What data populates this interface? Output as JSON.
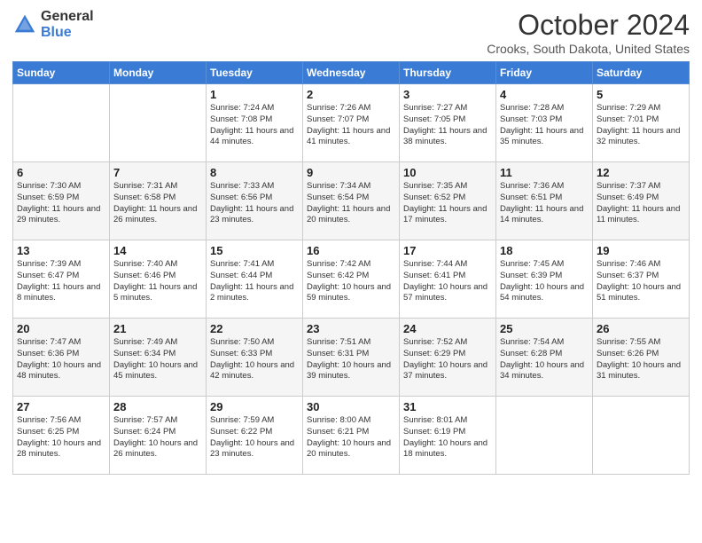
{
  "header": {
    "logo_general": "General",
    "logo_blue": "Blue",
    "month_title": "October 2024",
    "location": "Crooks, South Dakota, United States"
  },
  "days_of_week": [
    "Sunday",
    "Monday",
    "Tuesday",
    "Wednesday",
    "Thursday",
    "Friday",
    "Saturday"
  ],
  "weeks": [
    [
      {
        "day": "",
        "info": ""
      },
      {
        "day": "",
        "info": ""
      },
      {
        "day": "1",
        "info": "Sunrise: 7:24 AM\nSunset: 7:08 PM\nDaylight: 11 hours and 44 minutes."
      },
      {
        "day": "2",
        "info": "Sunrise: 7:26 AM\nSunset: 7:07 PM\nDaylight: 11 hours and 41 minutes."
      },
      {
        "day": "3",
        "info": "Sunrise: 7:27 AM\nSunset: 7:05 PM\nDaylight: 11 hours and 38 minutes."
      },
      {
        "day": "4",
        "info": "Sunrise: 7:28 AM\nSunset: 7:03 PM\nDaylight: 11 hours and 35 minutes."
      },
      {
        "day": "5",
        "info": "Sunrise: 7:29 AM\nSunset: 7:01 PM\nDaylight: 11 hours and 32 minutes."
      }
    ],
    [
      {
        "day": "6",
        "info": "Sunrise: 7:30 AM\nSunset: 6:59 PM\nDaylight: 11 hours and 29 minutes."
      },
      {
        "day": "7",
        "info": "Sunrise: 7:31 AM\nSunset: 6:58 PM\nDaylight: 11 hours and 26 minutes."
      },
      {
        "day": "8",
        "info": "Sunrise: 7:33 AM\nSunset: 6:56 PM\nDaylight: 11 hours and 23 minutes."
      },
      {
        "day": "9",
        "info": "Sunrise: 7:34 AM\nSunset: 6:54 PM\nDaylight: 11 hours and 20 minutes."
      },
      {
        "day": "10",
        "info": "Sunrise: 7:35 AM\nSunset: 6:52 PM\nDaylight: 11 hours and 17 minutes."
      },
      {
        "day": "11",
        "info": "Sunrise: 7:36 AM\nSunset: 6:51 PM\nDaylight: 11 hours and 14 minutes."
      },
      {
        "day": "12",
        "info": "Sunrise: 7:37 AM\nSunset: 6:49 PM\nDaylight: 11 hours and 11 minutes."
      }
    ],
    [
      {
        "day": "13",
        "info": "Sunrise: 7:39 AM\nSunset: 6:47 PM\nDaylight: 11 hours and 8 minutes."
      },
      {
        "day": "14",
        "info": "Sunrise: 7:40 AM\nSunset: 6:46 PM\nDaylight: 11 hours and 5 minutes."
      },
      {
        "day": "15",
        "info": "Sunrise: 7:41 AM\nSunset: 6:44 PM\nDaylight: 11 hours and 2 minutes."
      },
      {
        "day": "16",
        "info": "Sunrise: 7:42 AM\nSunset: 6:42 PM\nDaylight: 10 hours and 59 minutes."
      },
      {
        "day": "17",
        "info": "Sunrise: 7:44 AM\nSunset: 6:41 PM\nDaylight: 10 hours and 57 minutes."
      },
      {
        "day": "18",
        "info": "Sunrise: 7:45 AM\nSunset: 6:39 PM\nDaylight: 10 hours and 54 minutes."
      },
      {
        "day": "19",
        "info": "Sunrise: 7:46 AM\nSunset: 6:37 PM\nDaylight: 10 hours and 51 minutes."
      }
    ],
    [
      {
        "day": "20",
        "info": "Sunrise: 7:47 AM\nSunset: 6:36 PM\nDaylight: 10 hours and 48 minutes."
      },
      {
        "day": "21",
        "info": "Sunrise: 7:49 AM\nSunset: 6:34 PM\nDaylight: 10 hours and 45 minutes."
      },
      {
        "day": "22",
        "info": "Sunrise: 7:50 AM\nSunset: 6:33 PM\nDaylight: 10 hours and 42 minutes."
      },
      {
        "day": "23",
        "info": "Sunrise: 7:51 AM\nSunset: 6:31 PM\nDaylight: 10 hours and 39 minutes."
      },
      {
        "day": "24",
        "info": "Sunrise: 7:52 AM\nSunset: 6:29 PM\nDaylight: 10 hours and 37 minutes."
      },
      {
        "day": "25",
        "info": "Sunrise: 7:54 AM\nSunset: 6:28 PM\nDaylight: 10 hours and 34 minutes."
      },
      {
        "day": "26",
        "info": "Sunrise: 7:55 AM\nSunset: 6:26 PM\nDaylight: 10 hours and 31 minutes."
      }
    ],
    [
      {
        "day": "27",
        "info": "Sunrise: 7:56 AM\nSunset: 6:25 PM\nDaylight: 10 hours and 28 minutes."
      },
      {
        "day": "28",
        "info": "Sunrise: 7:57 AM\nSunset: 6:24 PM\nDaylight: 10 hours and 26 minutes."
      },
      {
        "day": "29",
        "info": "Sunrise: 7:59 AM\nSunset: 6:22 PM\nDaylight: 10 hours and 23 minutes."
      },
      {
        "day": "30",
        "info": "Sunrise: 8:00 AM\nSunset: 6:21 PM\nDaylight: 10 hours and 20 minutes."
      },
      {
        "day": "31",
        "info": "Sunrise: 8:01 AM\nSunset: 6:19 PM\nDaylight: 10 hours and 18 minutes."
      },
      {
        "day": "",
        "info": ""
      },
      {
        "day": "",
        "info": ""
      }
    ]
  ]
}
